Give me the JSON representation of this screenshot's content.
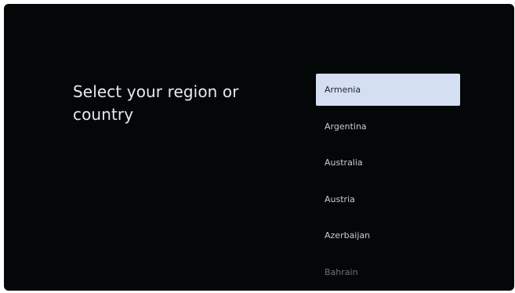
{
  "heading": "Select your region or country",
  "selected_index": 0,
  "countries": [
    {
      "label": "Armenia",
      "state": "selected"
    },
    {
      "label": "Argentina",
      "state": "normal"
    },
    {
      "label": "Australia",
      "state": "normal"
    },
    {
      "label": "Austria",
      "state": "normal"
    },
    {
      "label": "Azerbaijan",
      "state": "normal"
    },
    {
      "label": "Bahrain",
      "state": "faded"
    }
  ],
  "colors": {
    "background": "#030708",
    "selected_background": "#d5dff2",
    "selected_text": "#1d2330",
    "text": "#c8cdd6"
  }
}
